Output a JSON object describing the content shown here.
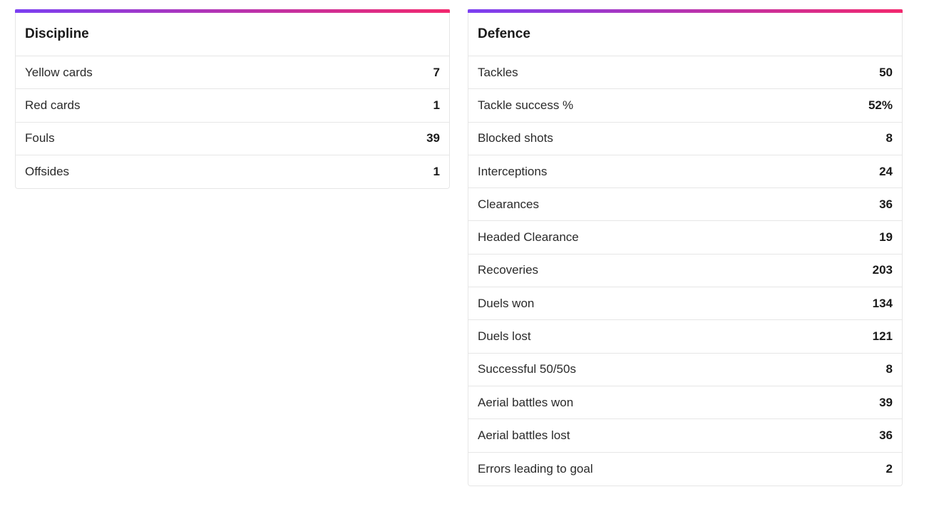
{
  "theme": {
    "accent_gradient_start": "#7b3ff2",
    "accent_gradient_end": "#f2286e"
  },
  "discipline": {
    "title": "Discipline",
    "rows": [
      {
        "label": "Yellow cards",
        "value": "7"
      },
      {
        "label": "Red cards",
        "value": "1"
      },
      {
        "label": "Fouls",
        "value": "39"
      },
      {
        "label": "Offsides",
        "value": "1"
      }
    ]
  },
  "defence": {
    "title": "Defence",
    "rows": [
      {
        "label": "Tackles",
        "value": "50"
      },
      {
        "label": "Tackle success %",
        "value": "52%"
      },
      {
        "label": "Blocked shots",
        "value": "8"
      },
      {
        "label": "Interceptions",
        "value": "24"
      },
      {
        "label": "Clearances",
        "value": "36"
      },
      {
        "label": "Headed Clearance",
        "value": "19"
      },
      {
        "label": "Recoveries",
        "value": "203"
      },
      {
        "label": "Duels won",
        "value": "134"
      },
      {
        "label": "Duels lost",
        "value": "121"
      },
      {
        "label": "Successful 50/50s",
        "value": "8"
      },
      {
        "label": "Aerial battles won",
        "value": "39"
      },
      {
        "label": "Aerial battles lost",
        "value": "36"
      },
      {
        "label": "Errors leading to goal",
        "value": "2"
      }
    ]
  }
}
